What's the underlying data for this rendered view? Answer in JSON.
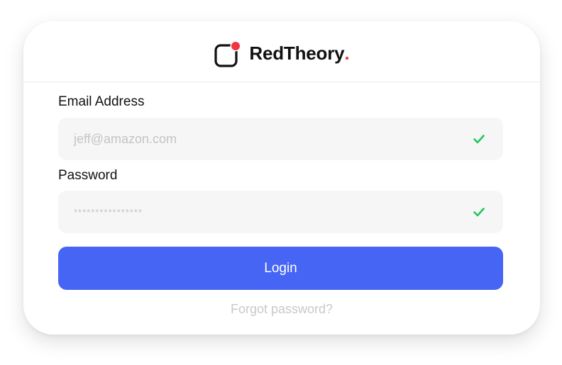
{
  "brand": {
    "name": "RedTheory",
    "dot": ".",
    "accent_color": "#f2353e",
    "logo_icon": "logo-mark-icon"
  },
  "form": {
    "email": {
      "label": "Email Address",
      "value": "jeff@amazon.com",
      "status_icon": "check-icon"
    },
    "password": {
      "label": "Password",
      "value": "****************",
      "status_icon": "check-icon"
    },
    "login_label": "Login",
    "forgot_label": "Forgot password?"
  },
  "colors": {
    "primary": "#4665f5",
    "success": "#22c55e",
    "field_bg": "#f6f6f6",
    "muted_text": "#c4c4c4"
  }
}
